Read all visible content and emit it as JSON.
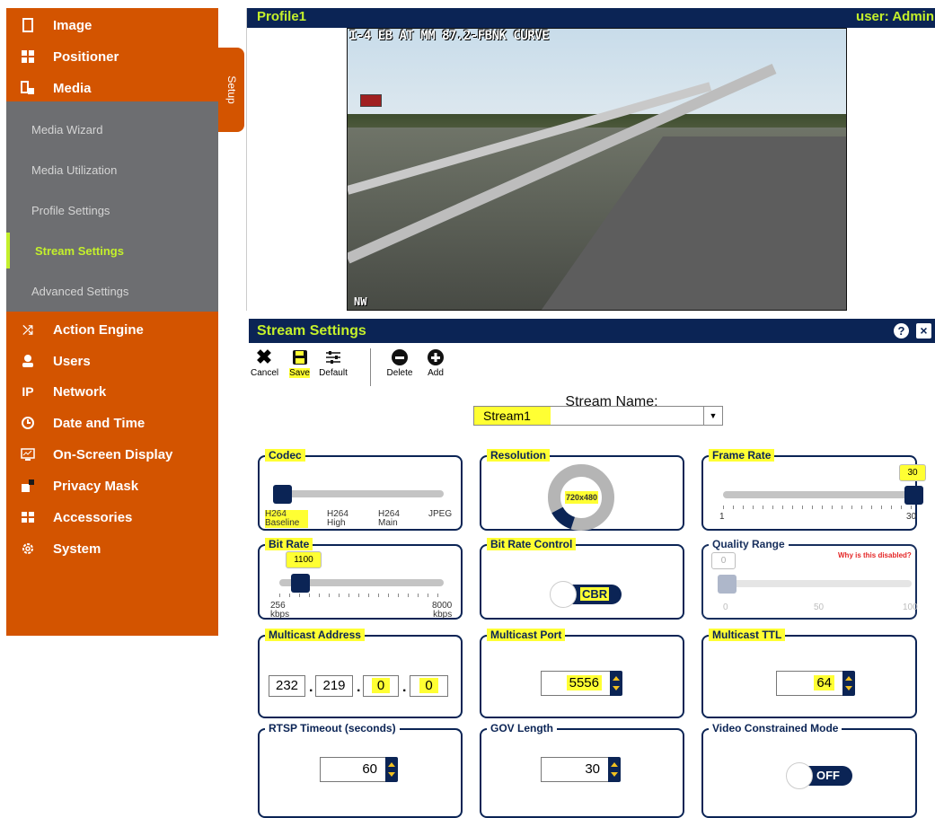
{
  "sidebar": {
    "items_top": [
      {
        "label": "Image",
        "icon": "rectangle"
      },
      {
        "label": "Positioner",
        "icon": "crosshair"
      },
      {
        "label": "Media",
        "icon": "media"
      }
    ],
    "media_submenu": [
      {
        "label": "Media Wizard"
      },
      {
        "label": "Media Utilization"
      },
      {
        "label": "Profile Settings"
      },
      {
        "label": "Stream Settings"
      },
      {
        "label": "Advanced Settings"
      }
    ],
    "items_bottom": [
      {
        "label": "Action Engine",
        "icon": "shuffle"
      },
      {
        "label": "Users",
        "icon": "user"
      },
      {
        "label": "Network",
        "icon": "IP"
      },
      {
        "label": "Date and Time",
        "icon": "clock"
      },
      {
        "label": "On-Screen Display",
        "icon": "monitor"
      },
      {
        "label": "Privacy Mask",
        "icon": "mask"
      },
      {
        "label": "Accessories",
        "icon": "grid"
      },
      {
        "label": "System",
        "icon": "gear"
      }
    ],
    "setup_tab": "Setup"
  },
  "video": {
    "profile": "Profile1",
    "user": "user: Admin",
    "overlay": "I-4 EB AT MM 87.2-FBNK CURVE",
    "direction": "NW"
  },
  "stream": {
    "title": "Stream Settings",
    "help": "?",
    "close": "×",
    "toolbar": {
      "cancel": "Cancel",
      "save": "Save",
      "default": "Default",
      "delete": "Delete",
      "add": "Add"
    },
    "name_label": "Stream Name:",
    "name_value": "Stream1",
    "codec": {
      "label": "Codec",
      "options": [
        "H264\nBaseline",
        "H264\nHigh",
        "H264\nMain",
        "JPEG"
      ],
      "opt1": "H264",
      "opt1b": "Baseline",
      "opt2": "H264",
      "opt2b": "High",
      "opt3": "H264",
      "opt3b": "Main",
      "opt4": "JPEG",
      "selected_index": 0
    },
    "resolution": {
      "label": "Resolution",
      "value": "720x480"
    },
    "frame_rate": {
      "label": "Frame Rate",
      "value": "30",
      "min": "1",
      "max": "30",
      "fraction": 1.0
    },
    "bit_rate": {
      "label": "Bit Rate",
      "value": "1100",
      "min": "256",
      "max": "8000",
      "unit": "kbps",
      "fraction": 0.11
    },
    "bit_rate_control": {
      "label": "Bit Rate Control",
      "value": "CBR"
    },
    "quality_range": {
      "label": "Quality Range",
      "value": "0",
      "warning": "Why is this disabled?",
      "ticks": [
        "0",
        "50",
        "100"
      ],
      "fraction": 0.0
    },
    "multicast_address": {
      "label": "Multicast Address",
      "octets": [
        "232",
        "219",
        "0",
        "0"
      ]
    },
    "multicast_port": {
      "label": "Multicast Port",
      "value": "5556"
    },
    "multicast_ttl": {
      "label": "Multicast TTL",
      "value": "64"
    },
    "rtsp_timeout": {
      "label": "RTSP Timeout (seconds)",
      "value": "60"
    },
    "gov_length": {
      "label": "GOV Length",
      "value": "30"
    },
    "video_constrained": {
      "label": "Video Constrained Mode",
      "value": "OFF"
    }
  },
  "colors": {
    "orange": "#d35400",
    "navy": "#0b2455",
    "lime": "#c4f02b",
    "highlight": "#ffff33",
    "submenu_gray": "#6d6e71"
  }
}
